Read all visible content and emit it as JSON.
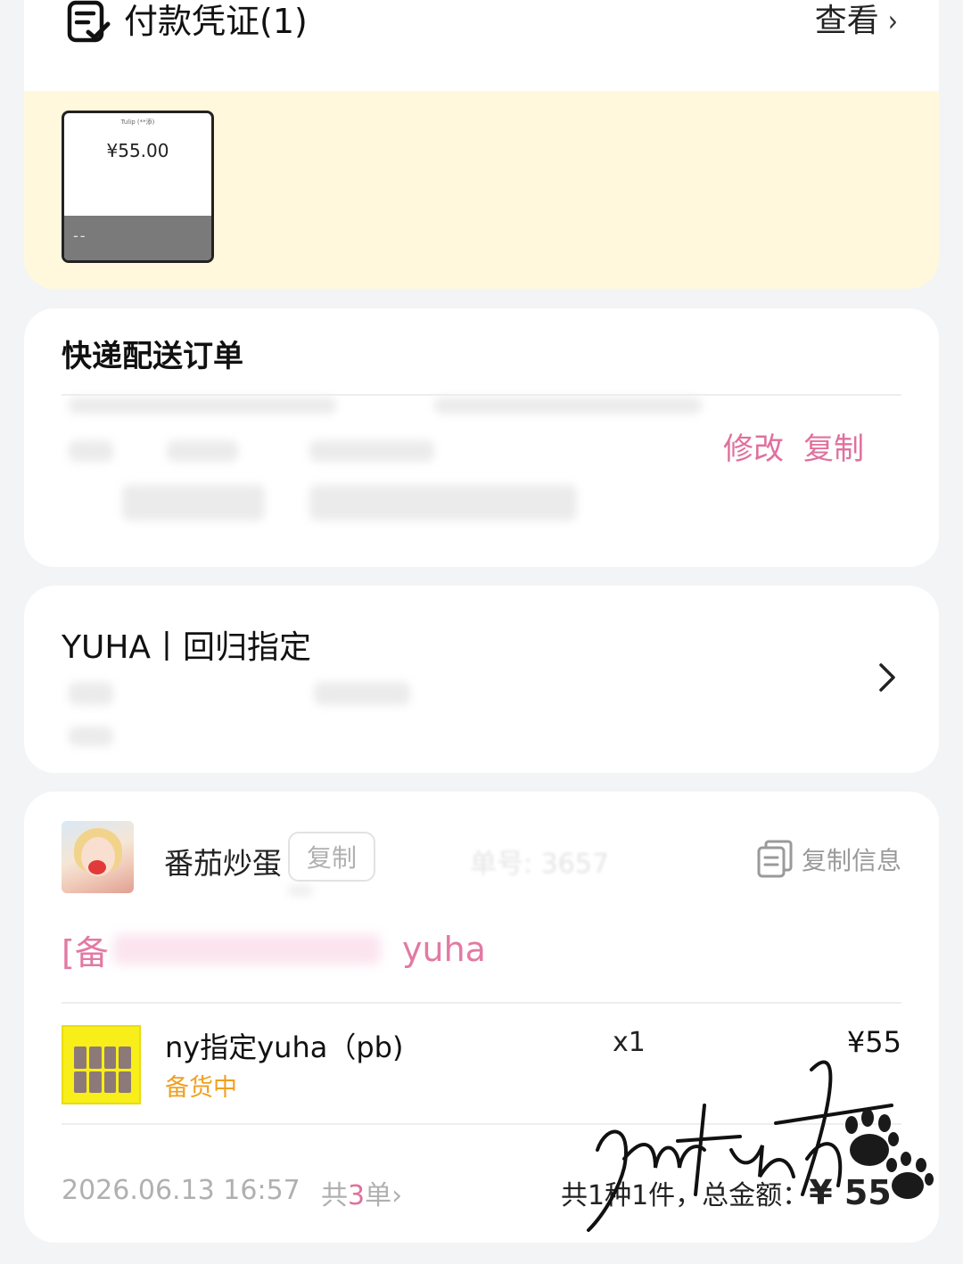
{
  "voucher": {
    "title": "付款凭证(1)",
    "view_label": "查看",
    "thumb": {
      "top_text": "Tulip  (**添)",
      "amount": "¥55.00",
      "placeholder": "--"
    }
  },
  "express": {
    "title": "快递配送订单",
    "edit_label": "修改",
    "copy_label": "复制"
  },
  "group": {
    "title": "YUHA丨回归指定"
  },
  "order": {
    "shop_name": "番茄炒蛋",
    "copy_label": "复制",
    "order_no": "单号: 3657",
    "copy_info_label": "复制信息",
    "remark_prefix": "[备",
    "remark_suffix": "yuha",
    "item": {
      "name": "ny指定yuha（pb)",
      "status": "备货中",
      "qty": "x1",
      "price": "¥55"
    },
    "footer": {
      "datetime": "2026.06.13 16:57",
      "count_prefix": "共",
      "count_num": "3",
      "count_suffix": "单›",
      "total_text": "共1种1件，总金额：",
      "total_amount": "¥ 55"
    }
  },
  "watermark_text": "ruteth"
}
